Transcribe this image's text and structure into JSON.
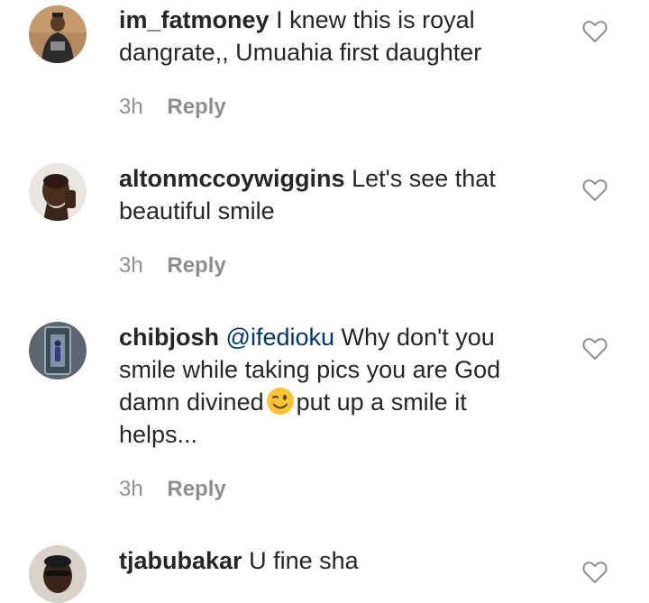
{
  "comments": [
    {
      "username": "im_fatmoney",
      "text": "I knew this is royal dangrate,, Umuahia first daughter",
      "time": "3h",
      "reply_label": "Reply",
      "avatar_icon": "avatar-photo-icon"
    },
    {
      "username": "altonmccoywiggins",
      "text": "Let's see that beautiful smile",
      "time": "3h",
      "reply_label": "Reply",
      "avatar_icon": "avatar-photo-icon"
    },
    {
      "username": "chibjosh",
      "mention": "@ifedioku",
      "text_before_emoji": "Why don't you smile while taking pics you are God damn divined",
      "emoji_icon": "winking-face-icon",
      "text_after_emoji": "put up a smile it helps...",
      "time": "3h",
      "reply_label": "Reply",
      "avatar_icon": "avatar-photo-icon"
    },
    {
      "username": "tjabubakar",
      "text": "U fine sha",
      "avatar_icon": "avatar-photo-icon"
    }
  ],
  "colors": {
    "text": "#262626",
    "meta": "#8e8e8e",
    "mention": "#00376b",
    "heart_outline": "#8e8e8e"
  }
}
